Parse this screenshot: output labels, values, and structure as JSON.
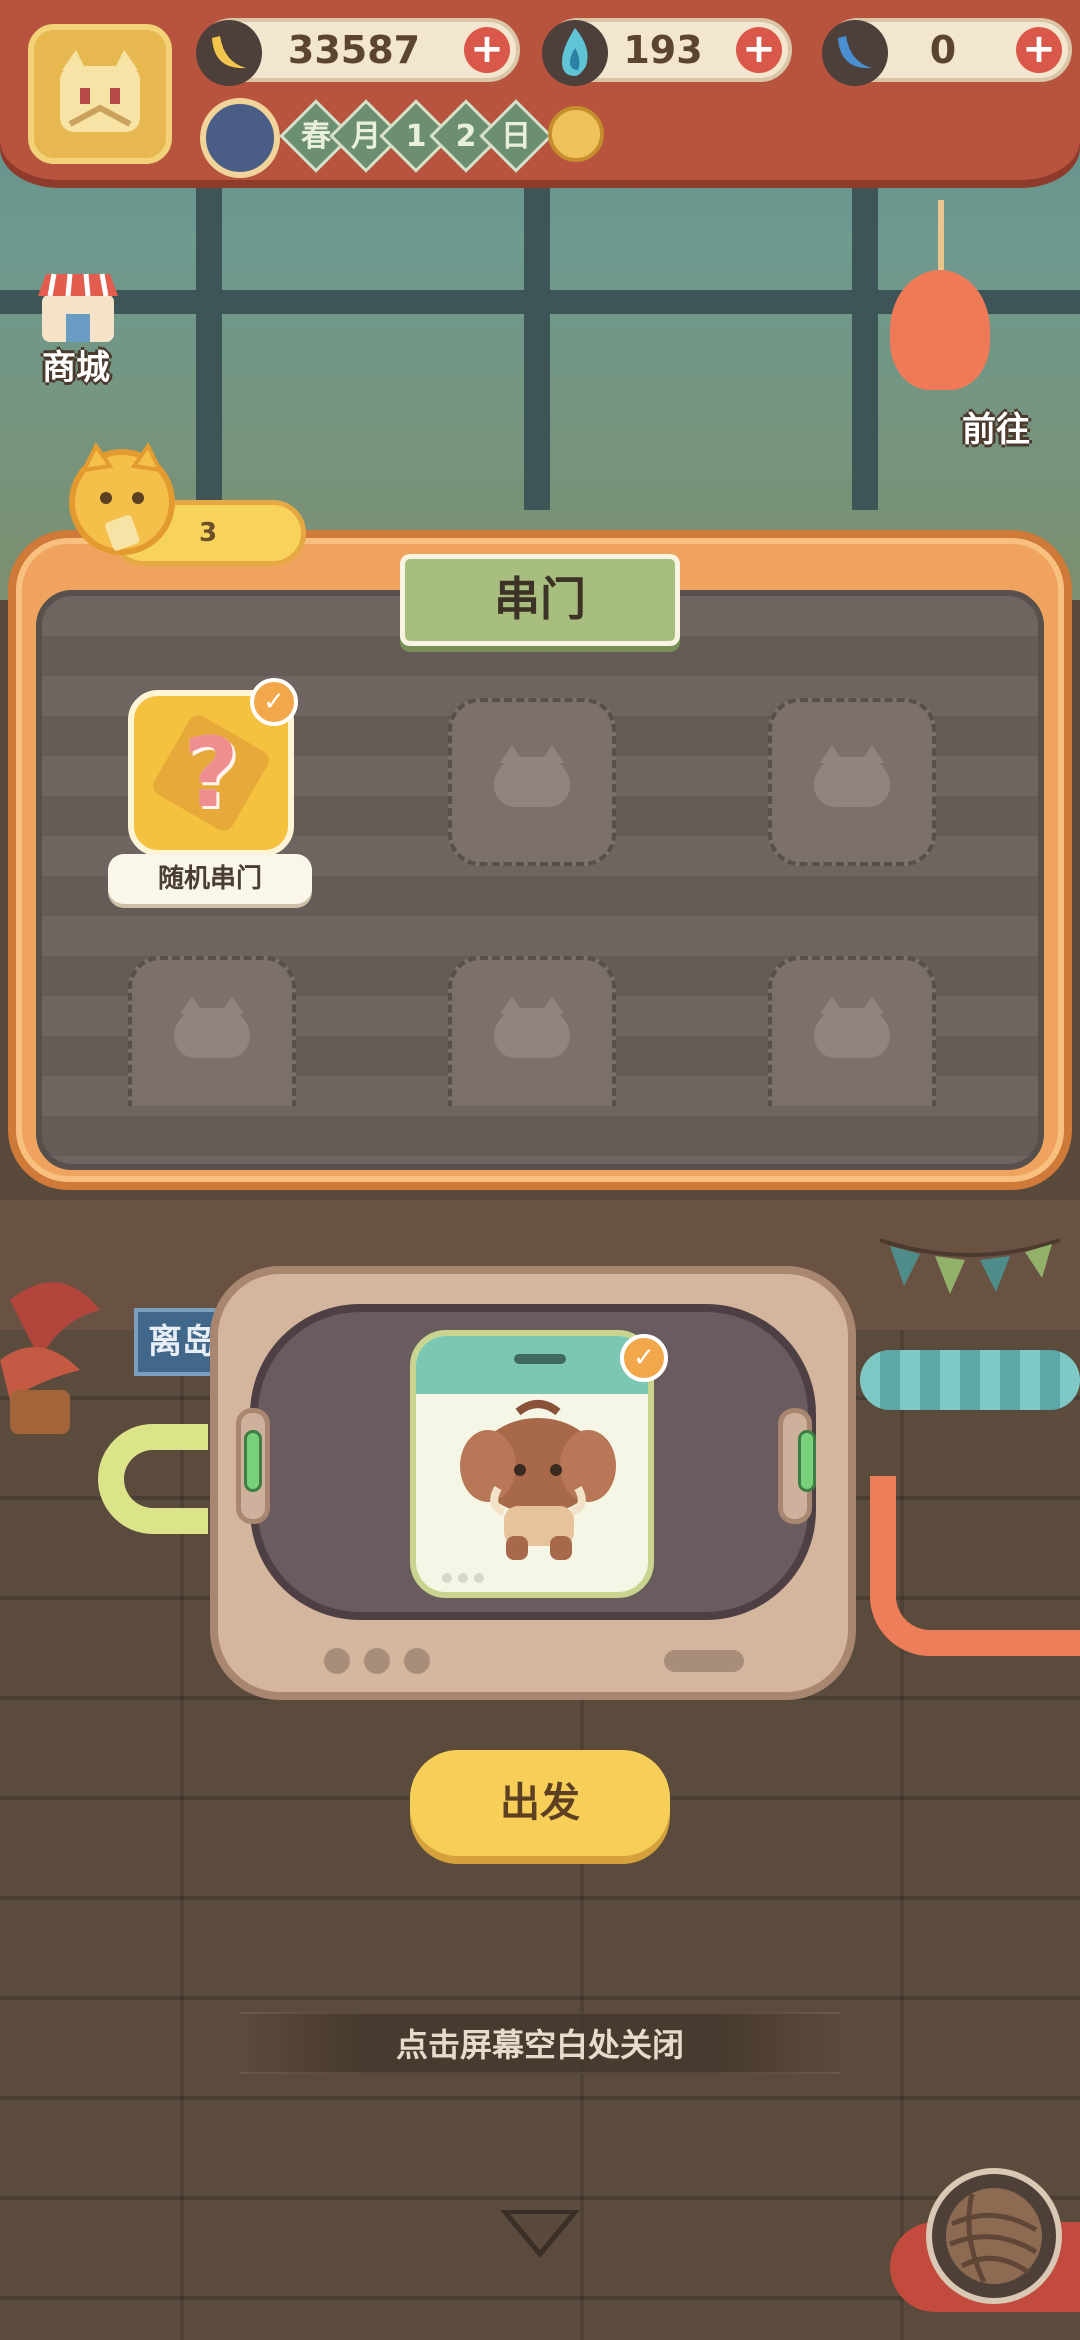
{
  "header": {
    "resources": [
      {
        "icon": "banana-icon",
        "value": "33587",
        "plus": "+"
      },
      {
        "icon": "blue-flame-icon",
        "value": "193",
        "plus": "+"
      },
      {
        "icon": "blue-banana-icon",
        "value": "0",
        "plus": "+"
      }
    ],
    "date_chars": [
      "春",
      "月",
      "1",
      "2",
      "日"
    ]
  },
  "side_buttons": {
    "shop_label": "商城",
    "go_label": "前往"
  },
  "panel": {
    "title": "串门",
    "count_badge": "3",
    "selected_door_label": "随机串门",
    "question_mark": "?",
    "empty_slot_count": 5
  },
  "scene": {
    "island_sign": "离岛"
  },
  "actions": {
    "depart_label": "出发",
    "close_hint": "点击屏幕空白处关闭"
  },
  "colors": {
    "accent_yellow": "#f7cf58",
    "panel_orange": "#f0a35e",
    "title_green": "#a8be7e",
    "check_orange": "#f2a74a"
  }
}
